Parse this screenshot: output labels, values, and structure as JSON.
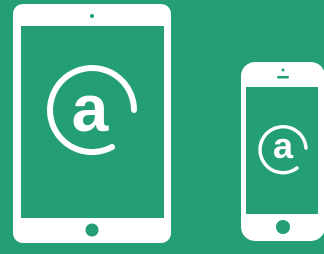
{
  "colors": {
    "background": "#239e75",
    "device_body": "#ffffff",
    "screen": "#239e75",
    "icon": "#ffffff"
  },
  "devices": [
    {
      "kind": "tablet",
      "screen_icon": "at-sign-icon",
      "home_button": "home-button",
      "camera": "front-camera-dot"
    },
    {
      "kind": "phone",
      "screen_icon": "at-sign-icon",
      "home_button": "home-button",
      "camera": "front-camera-dot",
      "speaker": "speaker-slot"
    }
  ]
}
